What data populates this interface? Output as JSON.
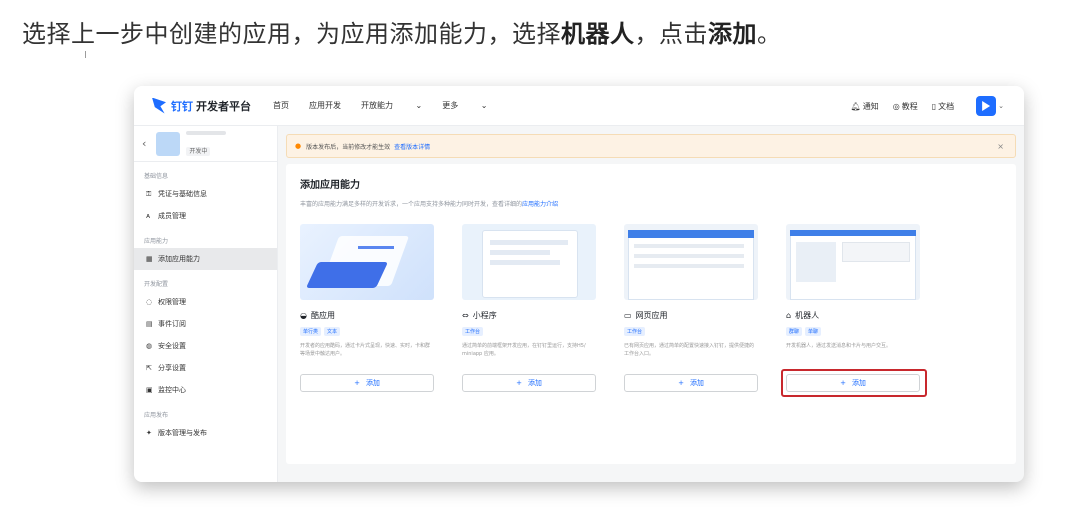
{
  "instruction": {
    "part1": "选择上一步中创建的应用，为应用添加能力，选择",
    "bold1": "机器人",
    "part2": "，点击",
    "bold2": "添加",
    "part3": "。"
  },
  "topbar": {
    "logo_brand": "钉钉",
    "logo_sub": "开发者平台",
    "nav": [
      "首页",
      "应用开发",
      "开放能力",
      "更多"
    ],
    "tools": {
      "notify": "通知",
      "tutorial": "教程",
      "docs": "文档"
    }
  },
  "sidebar": {
    "app_status": "开发中",
    "sections": [
      {
        "title": "基础信息",
        "items": [
          "凭证与基础信息",
          "成员管理"
        ]
      },
      {
        "title": "应用能力",
        "items": [
          "添加应用能力"
        ]
      },
      {
        "title": "开发配置",
        "items": [
          "权限管理",
          "事件订阅",
          "安全设置",
          "分享设置",
          "监控中心"
        ]
      },
      {
        "title": "应用发布",
        "items": [
          "版本管理与发布"
        ]
      }
    ]
  },
  "banner": {
    "text": "版本发布后，当前修改才能生效",
    "link": "查看版本详情"
  },
  "panel": {
    "title": "添加应用能力",
    "desc": "丰富的应用能力满足多样的开发诉求，一个应用支持多种能力同时开发，查看详细的",
    "desc_link": "应用能力介绍"
  },
  "cards": [
    {
      "name": "酷应用",
      "tags": [
        "单行类",
        "文本"
      ],
      "desc": "开发者的应用酷码，通过卡片式呈现，快速、实时，卡和群等场景中触达用户。",
      "add": "添加"
    },
    {
      "name": "小程序",
      "tags": [
        "工作台"
      ],
      "desc": "通过简单的前端框架开发应用，在钉钉里运行，支持H5/ miniapp 应用。",
      "add": "添加"
    },
    {
      "name": "网页应用",
      "tags": [
        "工作台"
      ],
      "desc": "已有网页应用，通过简单的配置快速接入钉钉，提供便捷的工作台入口。",
      "add": "添加"
    },
    {
      "name": "机器人",
      "tags": [
        "群聊",
        "单聊"
      ],
      "desc": "开发机器人，通过发送消息和卡片与用户交互。",
      "add": "添加"
    }
  ]
}
